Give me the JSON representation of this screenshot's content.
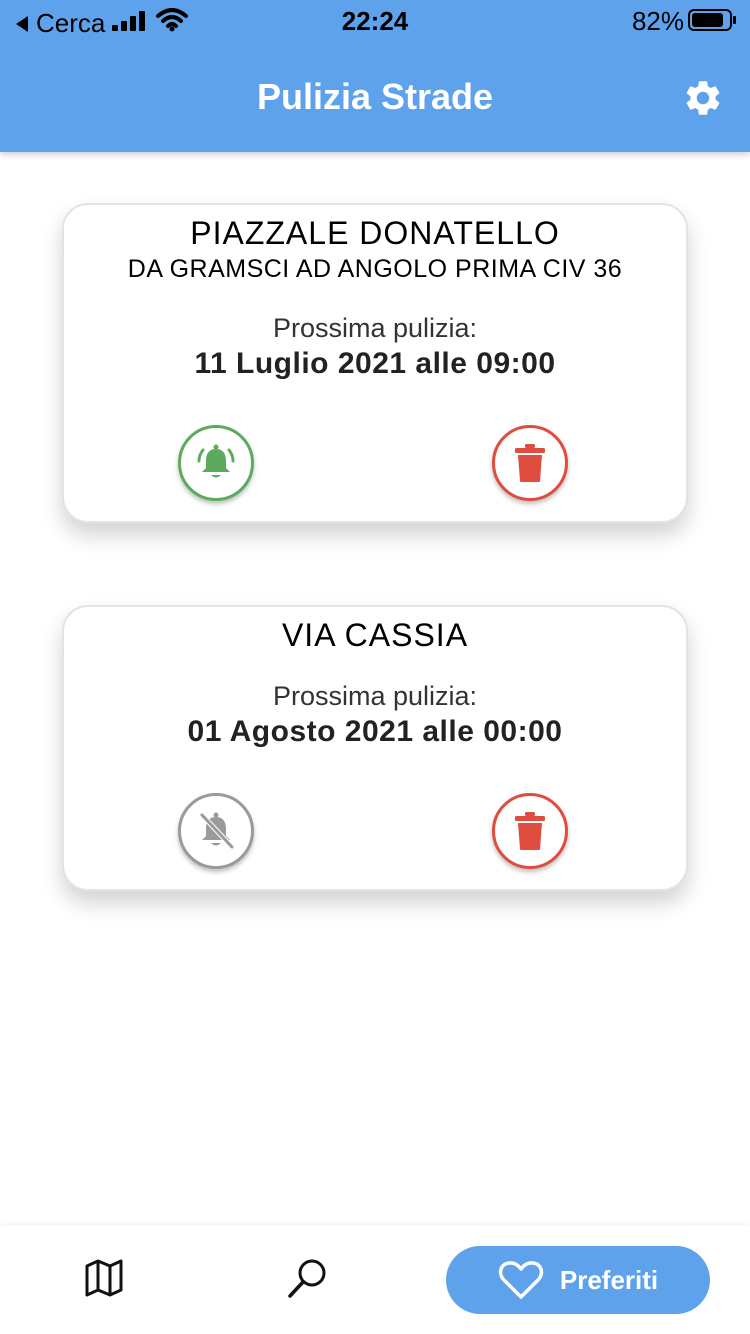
{
  "status_bar": {
    "back_label": "Cerca",
    "time": "22:24",
    "battery": "82%"
  },
  "header": {
    "title": "Pulizia Strade",
    "settings_icon": "gear-icon"
  },
  "cards": [
    {
      "street": "PIAZZALE DONATELLO",
      "detail": "DA GRAMSCI AD ANGOLO PRIMA CIV 36",
      "next_label": "Prossima pulizia:",
      "next_date": "11 Luglio 2021 alle 09:00",
      "notification": "bell-icon",
      "notification_color": "#5cab5c",
      "delete": "trash-icon",
      "delete_color": "#e04c3d"
    },
    {
      "street": "VIA CASSIA",
      "next_label": "Prossima pulizia:",
      "next_date": "01 Agosto 2021 alle 00:00",
      "notification": "bell-off-icon",
      "notification_color": "#9a9a9a",
      "delete": "trash-icon",
      "delete_color": "#e04c3d"
    }
  ],
  "bottom_nav": {
    "items": [
      {
        "icon": "map-icon"
      },
      {
        "icon": "search-icon"
      },
      {
        "icon": "heart-icon",
        "label": "Preferiti",
        "active": true
      }
    ],
    "accent": "#5fa2ec"
  }
}
